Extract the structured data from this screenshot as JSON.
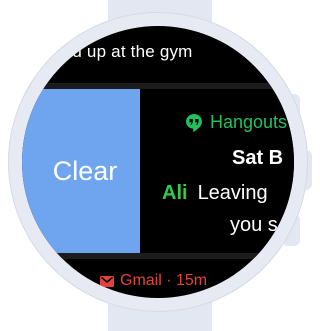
{
  "peek_top": {
    "text": "you up at the gym"
  },
  "swipe_action": {
    "label": "Clear"
  },
  "notification": {
    "app_name": "Hangouts",
    "app_icon": "hangouts-icon",
    "app_color": "#22c25a",
    "title": "Sat B",
    "sender": "Ali",
    "message_line1": "Leaving",
    "message_line2": "you s"
  },
  "peek_bottom": {
    "app_icon": "gmail-icon",
    "text": "Gmail · 15m",
    "color": "#e5423a"
  },
  "colors": {
    "clear_panel": "#6fa4ef",
    "screen_bg": "#000000",
    "bezel": "#e7eaf2"
  }
}
